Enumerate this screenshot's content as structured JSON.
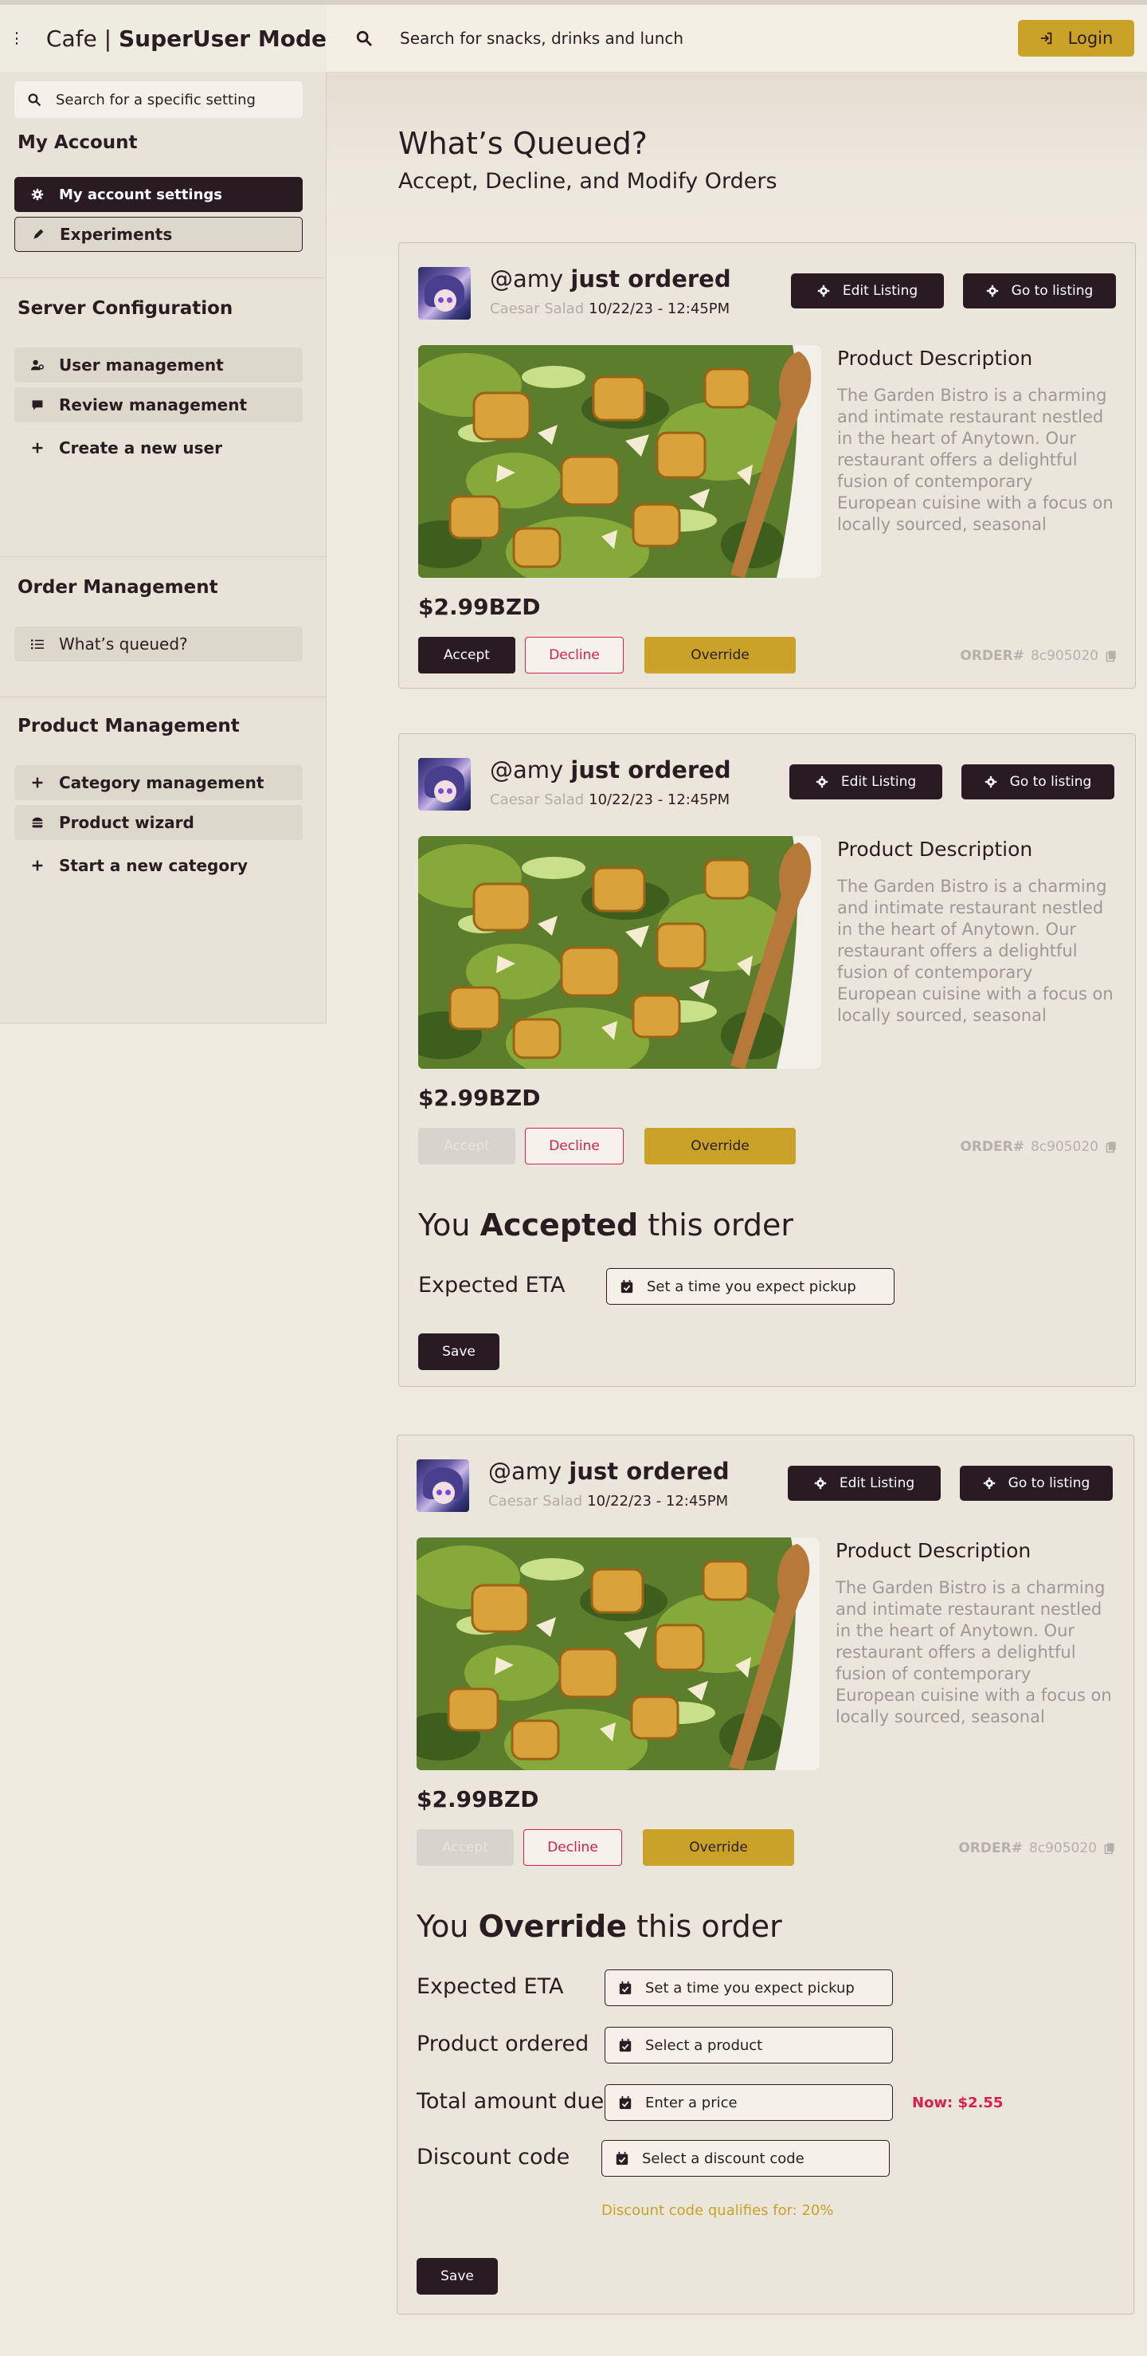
{
  "header": {
    "brand_name": "Cafe",
    "brand_mode": "SuperUser Mode",
    "search_placeholder": "Search for snacks, drinks and lunch",
    "login_label": "Login"
  },
  "sidebar": {
    "search_placeholder": "Search for a specific setting",
    "sections": [
      {
        "title": "My Account",
        "items": [
          {
            "label": "My account settings",
            "icon": "gear-icon"
          },
          {
            "label": "Experiments",
            "icon": "pencil-icon"
          }
        ]
      },
      {
        "title": "Server Configuration",
        "items": [
          {
            "label": "User management",
            "icon": "user-gear-icon"
          },
          {
            "label": "Review management",
            "icon": "comment-icon"
          },
          {
            "label": "Create a new user",
            "icon": "plus-icon"
          }
        ]
      },
      {
        "title": "Order Management",
        "items": [
          {
            "label": "What’s queued?",
            "icon": "list-icon"
          }
        ]
      },
      {
        "title": "Product Management",
        "items": [
          {
            "label": "Category management",
            "icon": "plus-icon"
          },
          {
            "label": "Product wizard",
            "icon": "burger-icon"
          },
          {
            "label": "Start a new category",
            "icon": "plus-icon"
          }
        ]
      }
    ]
  },
  "main": {
    "title": "What’s Queued?",
    "subtitle": "Accept, Decline, and Modify Orders"
  },
  "orders": [
    {
      "user": "@amy",
      "action": "just ordered",
      "item": "Caesar Salad",
      "datetime": "10/22/23 - 12:45PM",
      "edit_label": "Edit Listing",
      "goto_label": "Go to listing",
      "desc_title": "Product Description",
      "description": "The Garden Bistro is a charming and intimate restaurant nestled in the heart of Anytown. Our restaurant offers a delightful fusion of contemporary European cuisine with a focus on locally sourced, seasonal ingredients. Whether you're seeking a romantic dinner, a family celebr...",
      "price": "$2.99BZD",
      "accept_label": "Accept",
      "decline_label": "Decline",
      "override_label": "Override",
      "order_label": "ORDER#",
      "order_id": "8c905020"
    },
    {
      "user": "@amy",
      "action": "just ordered",
      "item": "Caesar Salad",
      "datetime": "10/22/23 - 12:45PM",
      "edit_label": "Edit Listing",
      "goto_label": "Go to listing",
      "desc_title": "Product Description",
      "description": "The Garden Bistro is a charming and intimate restaurant nestled in the heart of Anytown. Our restaurant offers a delightful fusion of contemporary European cuisine with a focus on locally sourced, seasonal ingredients. Whether you're seeking a romantic dinner, a family celebr...",
      "price": "$2.99BZD",
      "accept_label": "Accept",
      "decline_label": "Decline",
      "override_label": "Override",
      "order_label": "ORDER#",
      "order_id": "8c905020",
      "status_prefix": "You",
      "status_word": "Accepted",
      "status_suffix": "this order",
      "eta_label": "Expected ETA",
      "eta_placeholder": "Set a time you expect pickup",
      "save_label": "Save"
    },
    {
      "user": "@amy",
      "action": "just ordered",
      "item": "Caesar Salad",
      "datetime": "10/22/23 - 12:45PM",
      "edit_label": "Edit Listing",
      "goto_label": "Go to listing",
      "desc_title": "Product Description",
      "description": "The Garden Bistro is a charming and intimate restaurant nestled in the heart of Anytown. Our restaurant offers a delightful fusion of contemporary European cuisine with a focus on locally sourced, seasonal ingredients. Whether you're seeking a romantic dinner, a family celebr...",
      "price": "$2.99BZD",
      "accept_label": "Accept",
      "decline_label": "Decline",
      "override_label": "Override",
      "order_label": "ORDER#",
      "order_id": "8c905020",
      "status_prefix": "You",
      "status_word": "Override",
      "status_suffix": "this order",
      "eta_label": "Expected ETA",
      "eta_placeholder": "Set a time you expect pickup",
      "product_label": "Product ordered",
      "product_placeholder": "Select a product",
      "total_label": "Total amount due",
      "total_placeholder": "Enter a price",
      "now_price": "Now: $2.55",
      "discount_label": "Discount code",
      "discount_placeholder": "Select a discount code",
      "discount_note": "Discount code qualifies for: 20%",
      "save_label": "Save"
    }
  ],
  "colors": {
    "dark": "#2a1a22",
    "gold": "#c9a227",
    "red": "#d7204f",
    "background": "#efeae0"
  }
}
